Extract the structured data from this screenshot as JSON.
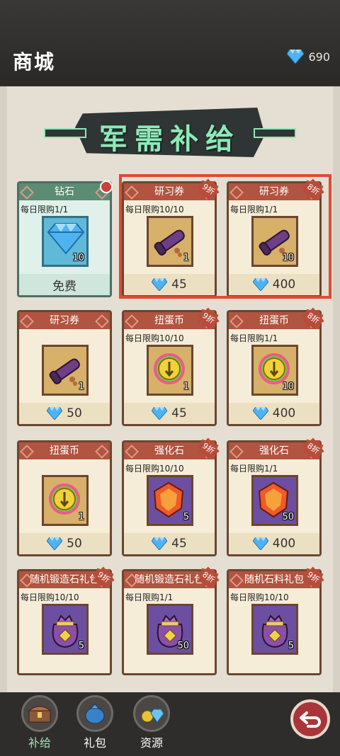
{
  "header": {
    "title": "商城",
    "gems": "690"
  },
  "banner": {
    "title": "军需补给"
  },
  "cards": [
    {
      "title": "钻石",
      "limit": "每日限购1/1",
      "qty": "10",
      "price": "免费",
      "icon": "diamond-icon",
      "free": true
    },
    {
      "title": "研习券",
      "limit": "每日限购10/10",
      "qty": "1",
      "price": "45",
      "icon": "scroll-icon",
      "discount": "9折"
    },
    {
      "title": "研习券",
      "limit": "每日限购1/1",
      "qty": "10",
      "price": "400",
      "icon": "scroll-icon",
      "discount": "8折"
    },
    {
      "title": "研习券",
      "limit": "",
      "qty": "1",
      "price": "50",
      "icon": "scroll-icon"
    },
    {
      "title": "扭蛋币",
      "limit": "每日限购10/10",
      "qty": "1",
      "price": "45",
      "icon": "coin-icon",
      "discount": "9折"
    },
    {
      "title": "扭蛋币",
      "limit": "每日限购1/1",
      "qty": "10",
      "price": "400",
      "icon": "coin-icon",
      "discount": "8折"
    },
    {
      "title": "扭蛋币",
      "limit": "",
      "qty": "1",
      "price": "50",
      "icon": "coin-icon"
    },
    {
      "title": "强化石",
      "limit": "每日限购10/10",
      "qty": "5",
      "price": "45",
      "icon": "enhance-stone-icon",
      "discount": "9折"
    },
    {
      "title": "强化石",
      "limit": "每日限购1/1",
      "qty": "50",
      "price": "400",
      "icon": "enhance-stone-icon",
      "discount": "8折"
    },
    {
      "title": "随机锻造石礼包",
      "limit": "每日限购10/10",
      "qty": "5",
      "icon": "gift-bag-icon",
      "discount": "9折"
    },
    {
      "title": "随机锻造石礼包",
      "limit": "每日限购1/1",
      "qty": "50",
      "icon": "gift-bag-icon",
      "discount": "8折"
    },
    {
      "title": "随机石料礼包",
      "limit": "每日限购10/10",
      "qty": "5",
      "icon": "gift-bag-icon",
      "discount": "9折"
    }
  ],
  "tabs": [
    {
      "label": "补给",
      "icon": "chest-icon",
      "active": true
    },
    {
      "label": "礼包",
      "icon": "bag-icon"
    },
    {
      "label": "资源",
      "icon": "resources-icon"
    }
  ],
  "colors": {
    "highlight": "#e04a33",
    "accent_green": "#8fe8b8",
    "card_header": "#b15440"
  }
}
